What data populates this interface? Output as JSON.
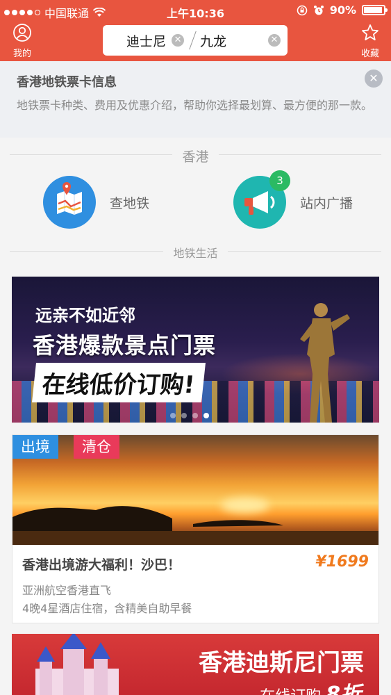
{
  "status_bar": {
    "carrier": "中国联通",
    "time": "上午10:36",
    "battery": "90%"
  },
  "header": {
    "left_label": "我的",
    "right_label": "收藏",
    "from_station": "迪士尼",
    "to_station": "九龙",
    "clear_symbol": "✕"
  },
  "notice": {
    "title": "香港地铁票卡信息",
    "description": "地铁票卡种类、费用及优惠介绍，帮助你选择最划算、最方便的那一款。",
    "close_symbol": "✕"
  },
  "city_section": {
    "label": "香港"
  },
  "tools": [
    {
      "label": "查地铁",
      "icon": "map-icon"
    },
    {
      "label": "站内广播",
      "icon": "megaphone-icon",
      "badge": "3"
    }
  ],
  "life_section": {
    "label": "地铁生活"
  },
  "banner": {
    "line1": "远亲不如近邻",
    "line2": "香港爆款景点门票",
    "line3": "在线低价订购!",
    "dots": 4,
    "active_dot": 3
  },
  "deal_card": {
    "tag1": "出境",
    "tag2": "清仓",
    "title": "香港出境游大福利！沙巴！",
    "price": "¥1699",
    "subtitle1": "亚洲航空香港直飞",
    "subtitle2": "4晚4星酒店住宿，含精美自助早餐"
  },
  "banner2": {
    "title": "香港迪斯尼门票",
    "subtitle_prefix": "在线订购",
    "discount": "8折"
  },
  "colors": {
    "brand": "#e8553f",
    "badge_green": "#2bba63",
    "price_orange": "#f07a1e"
  }
}
